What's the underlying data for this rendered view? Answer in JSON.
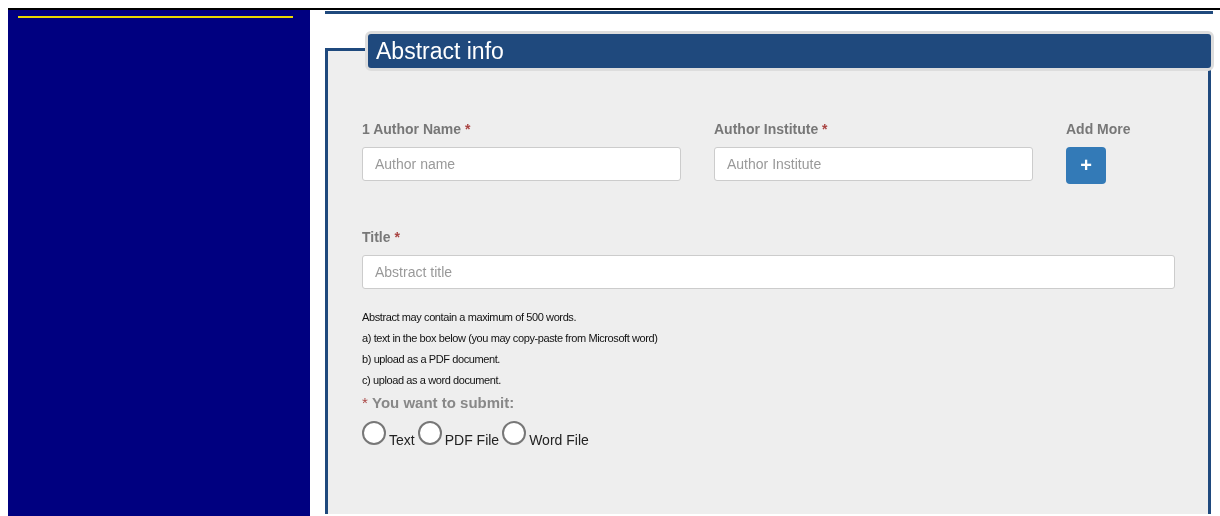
{
  "section": {
    "title": "Abstract info"
  },
  "author_row": {
    "fields": [
      {
        "label": "1 Author Name",
        "required_mark": "*",
        "placeholder": "Author name"
      },
      {
        "label": "Author Institute",
        "required_mark": "*",
        "placeholder": "Author Institute"
      }
    ],
    "add_more": {
      "label": "Add More",
      "button": "+"
    }
  },
  "title_field": {
    "label": "Title",
    "required_mark": "*",
    "placeholder": "Abstract title"
  },
  "instructions": [
    "Abstract may contain a maximum of 500 words.",
    "a) text in the box below (you may copy-paste from Microsoft word)",
    "b) upload as a PDF document.",
    "c) upload as a word document."
  ],
  "submit_choice": {
    "required_mark": "*",
    "label": "You want to submit:",
    "options": [
      {
        "label": "Text",
        "selected": false
      },
      {
        "label": "PDF File",
        "selected": false
      },
      {
        "label": "Word File",
        "selected": false
      }
    ]
  }
}
